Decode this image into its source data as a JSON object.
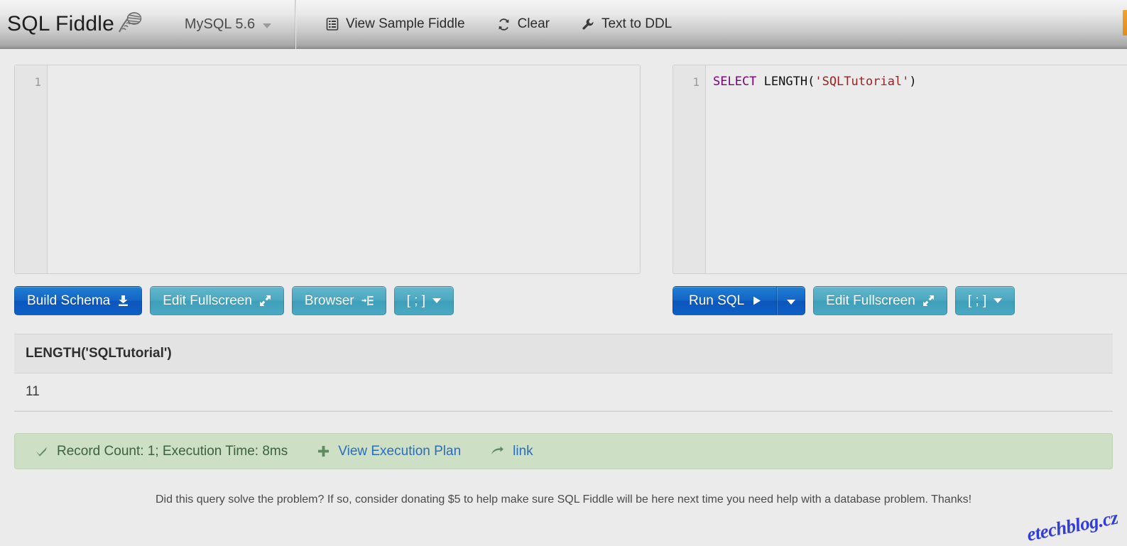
{
  "topbar": {
    "brand": "SQL Fiddle",
    "brand_logo_icon": "fiddle-scroll-icon",
    "database": "MySQL 5.6",
    "database_caret_icon": "chevron-down-icon",
    "actions": [
      {
        "label": "View Sample Fiddle",
        "icon": "list-document-icon"
      },
      {
        "label": "Clear",
        "icon": "refresh-icon"
      },
      {
        "label": "Text to DDL",
        "icon": "wrench-icon"
      }
    ]
  },
  "schema_panel": {
    "line_number": "1",
    "code": "",
    "buttons": [
      {
        "label": "Build Schema",
        "icon": "download-icon",
        "style": "blue"
      },
      {
        "label": "Edit Fullscreen",
        "icon": "expand-arrows-icon",
        "style": "teal"
      },
      {
        "label": "Browser",
        "icon": "indent-list-icon",
        "style": "teal"
      },
      {
        "label": "[ ; ]",
        "icon": "chevron-down-icon",
        "style": "teal"
      }
    ]
  },
  "query_panel": {
    "line_number": "1",
    "code": {
      "keyword": "SELECT",
      "space1": " ",
      "function": "LENGTH",
      "open_paren": "(",
      "string": "'SQLTutorial'",
      "close_paren": ")"
    },
    "run_button": {
      "label": "Run SQL",
      "icon": "play-icon",
      "caret_icon": "chevron-down-icon"
    },
    "buttons": [
      {
        "label": "Edit Fullscreen",
        "icon": "expand-arrows-icon",
        "style": "teal"
      },
      {
        "label": "[ ; ]",
        "icon": "chevron-down-icon",
        "style": "teal"
      }
    ]
  },
  "results": {
    "columns": [
      "LENGTH('SQLTutorial')"
    ],
    "rows": [
      [
        "11"
      ]
    ]
  },
  "status": {
    "check_icon": "check-icon",
    "summary": "Record Count: 1; Execution Time: 8ms",
    "plan_icon": "plus-icon",
    "plan_label": "View Execution Plan",
    "link_icon": "arrow-right-icon",
    "link_label": "link"
  },
  "footer": {
    "text": "Did this query solve the problem? If so, consider donating $5 to help make sure SQL Fiddle will be here next time you need help with a database problem. Thanks!"
  },
  "watermark": {
    "text": "etechblog.cz"
  },
  "colors": {
    "accent_blue": "#1464c4",
    "teal": "#4ba7c0",
    "status_green_bg": "#cddfc5",
    "status_green_text": "#3b633b",
    "link_blue": "#2a6ebb",
    "sql_keyword": "#7a007a",
    "sql_string": "#9c2020",
    "watermark_blue": "#2430d8",
    "edge_orange": "#e08b1d"
  }
}
